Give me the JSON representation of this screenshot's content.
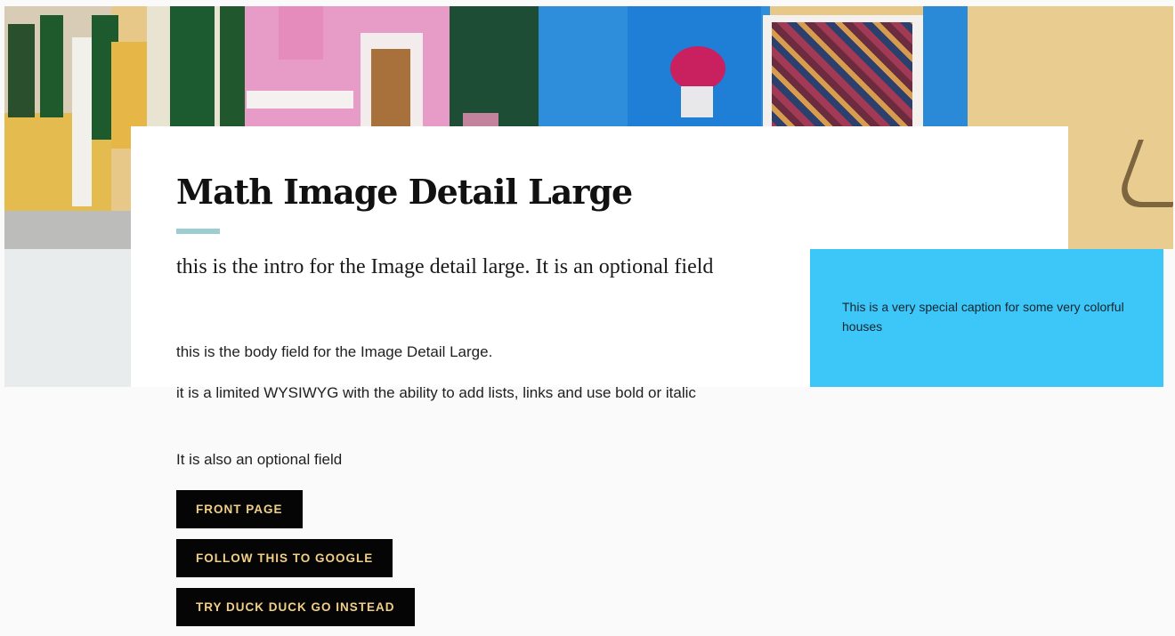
{
  "content": {
    "title": "Math Image Detail Large",
    "intro": "this is the intro for the Image detail large. It is an optional field",
    "body_paragraphs": [
      "this is the body field for the Image Detail Large.",
      "it is a limited WYSIWYG with the ability to add lists, links and use bold or italic",
      "It is also an optional field"
    ]
  },
  "caption": {
    "text": "This is a very special caption for some very colorful houses"
  },
  "buttons": [
    {
      "label": "FRONT PAGE"
    },
    {
      "label": "FOLLOW THIS TO GOOGLE"
    },
    {
      "label": "TRY DUCK DUCK GO INSTEAD"
    }
  ],
  "colors": {
    "accent_bar": "#9ccdd1",
    "caption_background": "#3cc7f8",
    "button_background": "#050505",
    "button_text": "#f2cf86"
  }
}
